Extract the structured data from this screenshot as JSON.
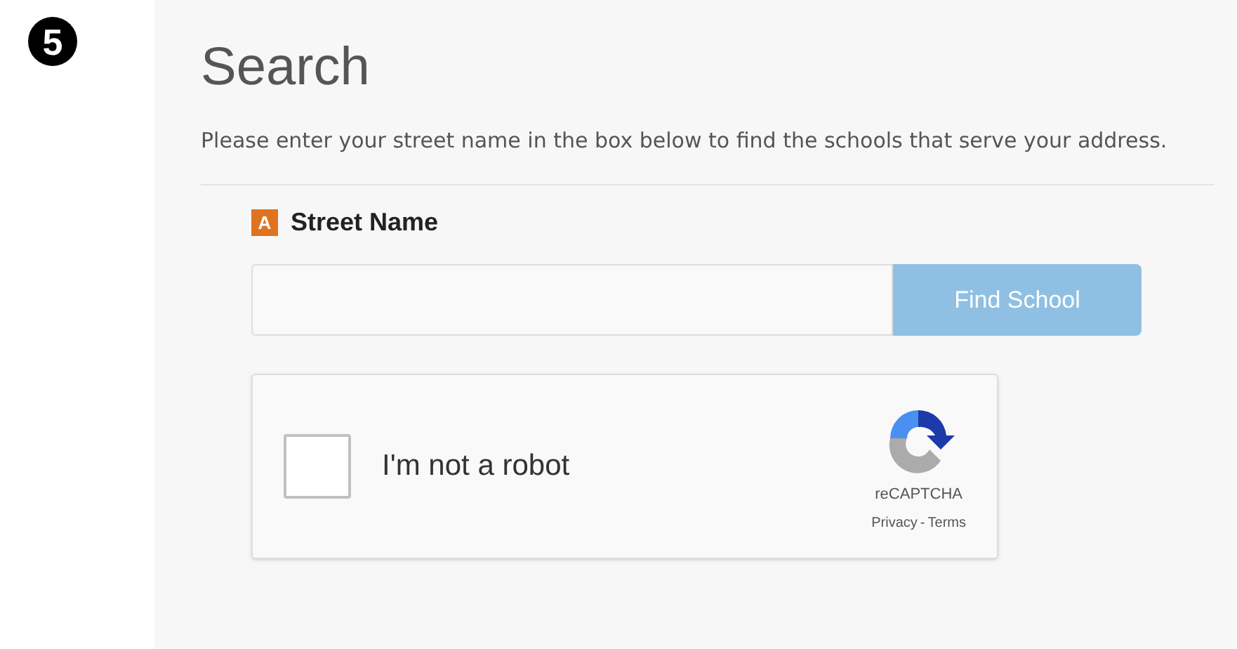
{
  "step_number": "5",
  "title": "Search",
  "description": "Please enter your street name in the box below to find the schools that serve your address.",
  "field": {
    "badge": "A",
    "label": "Street Name"
  },
  "find_button": {
    "label": "Find School",
    "disabled": true
  },
  "captcha": {
    "label": "I'm not a robot",
    "checked": false,
    "brand": "reCAPTCHA",
    "privacy": "Privacy",
    "separator": "-",
    "terms": "Terms"
  }
}
